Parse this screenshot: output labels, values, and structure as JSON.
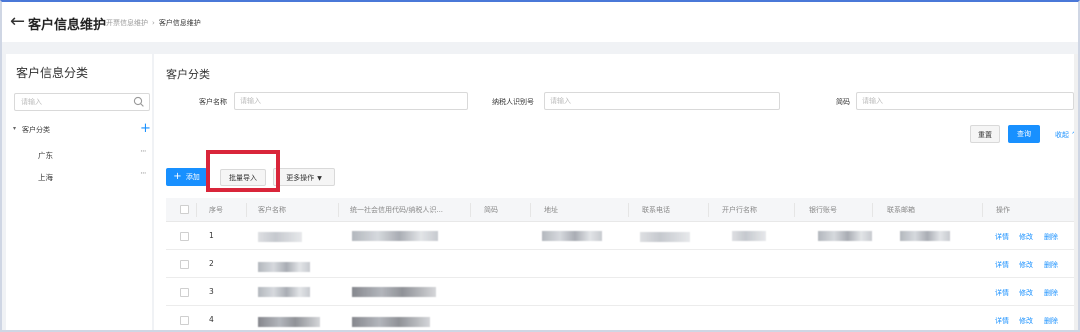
{
  "header": {
    "title": "客户信息维护",
    "breadcrumb": [
      "开票信息维护",
      "客户信息维护"
    ]
  },
  "sidebar": {
    "title": "客户信息分类",
    "search_placeholder": "请输入",
    "tree_root": "客户分类",
    "items": [
      {
        "label": "广东"
      },
      {
        "label": "上海"
      }
    ]
  },
  "main": {
    "title": "客户分类",
    "filters": {
      "customer_name_label": "客户名称",
      "customer_name_placeholder": "请输入",
      "tax_id_label": "纳税人识别号",
      "tax_id_placeholder": "请输入",
      "short_code_label": "简码",
      "short_code_placeholder": "请输入"
    },
    "buttons": {
      "reset": "重置",
      "query": "查询",
      "collapse": "收起 ^",
      "add": "添加",
      "batch_import": "批量导入",
      "more_actions": "更多操作"
    },
    "table": {
      "columns": [
        "序号",
        "客户名称",
        "统一社会信用代码/纳税人识...",
        "简码",
        "地址",
        "联系电话",
        "开户行名称",
        "银行账号",
        "联系邮箱",
        "操作"
      ],
      "rows": [
        {
          "index": "1"
        },
        {
          "index": "2"
        },
        {
          "index": "3"
        },
        {
          "index": "4"
        }
      ],
      "row_actions": {
        "detail": "详情",
        "edit": "修改",
        "delete": "删除"
      }
    }
  },
  "colors": {
    "primary": "#1890ff",
    "highlight": "#d9253a"
  }
}
